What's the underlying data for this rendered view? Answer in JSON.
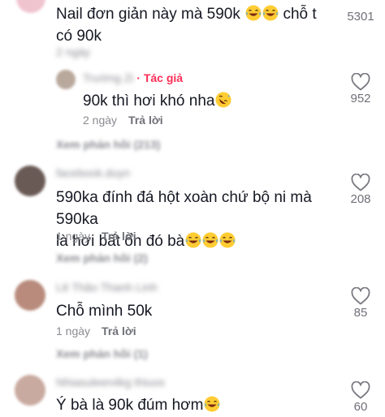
{
  "comments": [
    {
      "text": "Nail đơn giản này mà 590k",
      "text_after": "chỗ t có 90k",
      "timestamp": "2 ngày",
      "likes": "5301"
    },
    {
      "username": "Trường Zi",
      "author_badge": "Tác giả",
      "text": "90k thì hơi khó nha",
      "timestamp": "2 ngày",
      "reply_label": "Trả lời",
      "likes": "952"
    },
    {
      "username": "facebook.duyn",
      "text_line1": "590ka đính đá hột xoàn chứ bộ ni mà 590ka",
      "text_line2": "là hơi bất ổn đó bà",
      "timestamp": "1 ngày",
      "reply_label": "Trả lời",
      "likes": "208"
    },
    {
      "username": "Lê Thảo Thanh Linh",
      "text": "Chỗ mình 50k",
      "timestamp": "1 ngày",
      "reply_label": "Trả lời",
      "likes": "85"
    },
    {
      "username": "Nhiasuleen4kg thiuos",
      "text": "Ý bà là 90k đúm hơm",
      "likes": "60"
    }
  ],
  "view_replies": [
    "Xem phản hồi (213)",
    "Xem phản hồi (2)",
    "Xem phản hồi (1)"
  ],
  "colors": {
    "text": "#161823",
    "muted": "#8a8b91",
    "accent": "#fe2c55"
  },
  "icons": {
    "like": "heart-outline-icon",
    "laugh": "tears-of-joy-emoji",
    "rofl": "rolling-laughing-emoji"
  }
}
